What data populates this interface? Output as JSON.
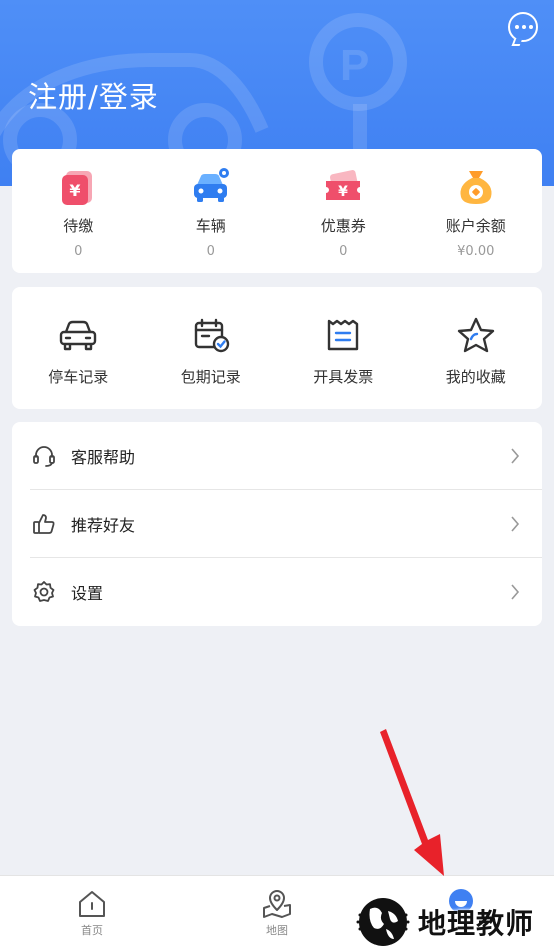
{
  "header": {
    "login_label": "注册/登录"
  },
  "stats": [
    {
      "label": "待缴",
      "value": "0",
      "icon": "bill-icon"
    },
    {
      "label": "车辆",
      "value": "0",
      "icon": "vehicle-icon"
    },
    {
      "label": "优惠券",
      "value": "0",
      "icon": "coupon-icon"
    },
    {
      "label": "账户余额",
      "value": "¥0.00",
      "icon": "money-bag-icon"
    }
  ],
  "services": [
    {
      "label": "停车记录",
      "icon": "car-icon"
    },
    {
      "label": "包期记录",
      "icon": "calendar-check-icon"
    },
    {
      "label": "开具发票",
      "icon": "invoice-icon"
    },
    {
      "label": "我的收藏",
      "icon": "star-icon"
    }
  ],
  "menu": [
    {
      "label": "客服帮助",
      "icon": "headset-icon"
    },
    {
      "label": "推荐好友",
      "icon": "thumbs-up-icon"
    },
    {
      "label": "设置",
      "icon": "gear-icon"
    }
  ],
  "tabbar": [
    {
      "label": "首页",
      "icon": "home-icon"
    },
    {
      "label": "地图",
      "icon": "map-pin-icon"
    }
  ],
  "watermark": {
    "text": "地理教师"
  },
  "colors": {
    "primary": "#3f80f2",
    "annotation_arrow": "#e8222a"
  }
}
